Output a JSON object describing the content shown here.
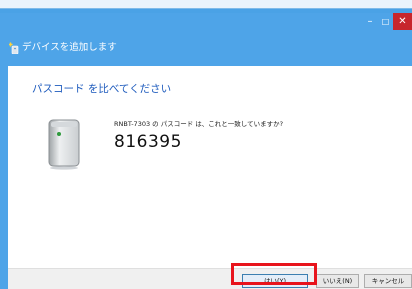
{
  "window": {
    "title": "デバイスを追加します",
    "controls": {
      "minimize": "–",
      "maximize": "□",
      "close": "✕"
    },
    "colors": {
      "frame": "#4ea4e8",
      "close": "#c7262c",
      "highlight": "#e8141c"
    }
  },
  "content": {
    "instruction": "パスコード を比べてください",
    "question": "RNBT-7303 の パスコード は、これと一致していますか?",
    "passcode": "816395",
    "device_icon": "device-icon"
  },
  "buttons": {
    "yes": "はい(Y)",
    "no": "いいえ(N)",
    "cancel": "キャンセル"
  }
}
